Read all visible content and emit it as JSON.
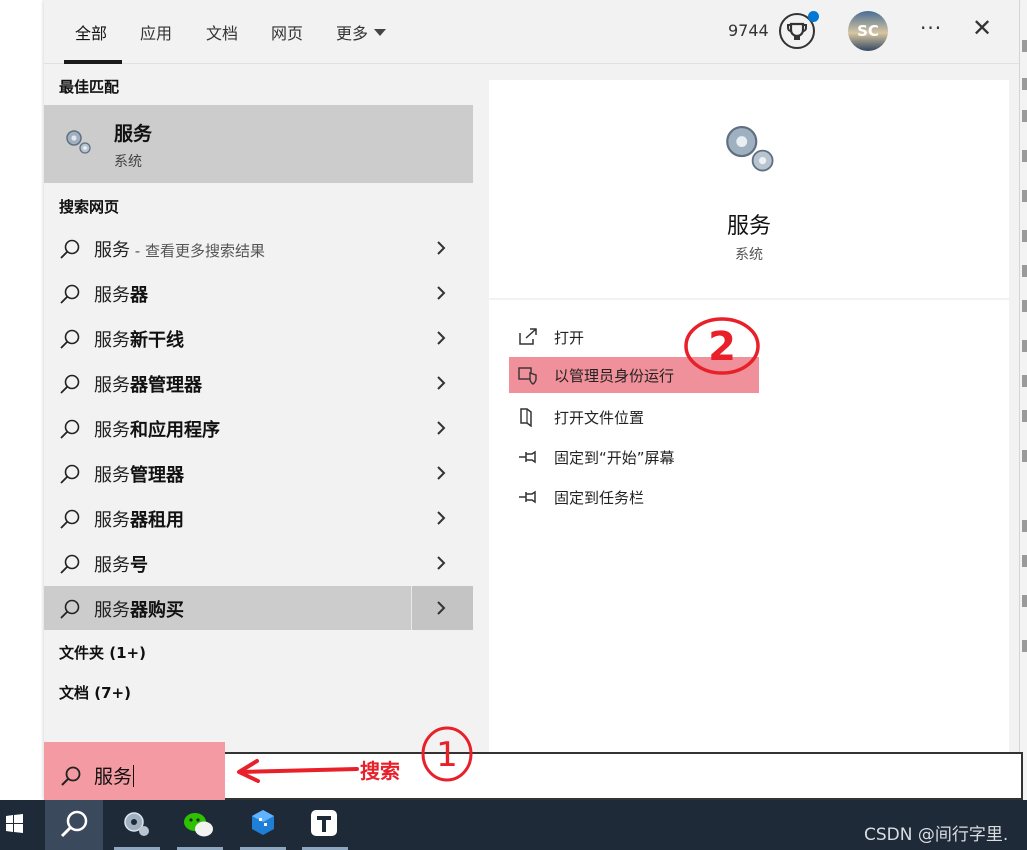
{
  "tabs": [
    {
      "label": "全部",
      "active": true
    },
    {
      "label": "应用"
    },
    {
      "label": "文档"
    },
    {
      "label": "网页"
    },
    {
      "label": "更多"
    }
  ],
  "header": {
    "points": "9744",
    "avatar_initials": "SC",
    "more_icon": "···",
    "close_icon": "✕"
  },
  "best_match": {
    "section_title": "最佳匹配",
    "title": "服务",
    "subtitle": "系统",
    "icon": "gears-icon"
  },
  "web_search": {
    "section_title": "搜索网页",
    "items": [
      {
        "prefix": "服务",
        "bold": "",
        "suffix": " - 查看更多搜索结果"
      },
      {
        "prefix": "服务",
        "bold": "器",
        "suffix": ""
      },
      {
        "prefix": "服务",
        "bold": "新干线",
        "suffix": ""
      },
      {
        "prefix": "服务",
        "bold": "器管理器",
        "suffix": ""
      },
      {
        "prefix": "服务",
        "bold": "和应用程序",
        "suffix": ""
      },
      {
        "prefix": "服务",
        "bold": "管理器",
        "suffix": ""
      },
      {
        "prefix": "服务",
        "bold": "器租用",
        "suffix": ""
      },
      {
        "prefix": "服务",
        "bold": "号",
        "suffix": ""
      },
      {
        "prefix": "服务",
        "bold": "器购买",
        "suffix": "",
        "selected": true
      }
    ]
  },
  "categories": [
    {
      "label": "文件夹 (1+)"
    },
    {
      "label": "文档 (7+)"
    }
  ],
  "detail": {
    "title": "服务",
    "subtitle": "系统",
    "actions": [
      {
        "label": "打开",
        "icon": "open-external-icon"
      },
      {
        "label": "以管理员身份运行",
        "icon": "shield-icon",
        "highlighted": true
      },
      {
        "label": "打开文件位置",
        "icon": "folder-location-icon"
      },
      {
        "label": "固定到“开始”屏幕",
        "icon": "pin-icon"
      },
      {
        "label": "固定到任务栏",
        "icon": "pin-icon"
      }
    ]
  },
  "search": {
    "value": "服务"
  },
  "annotations": {
    "search_label": "搜索",
    "step1": "1",
    "step2": "2",
    "color": "#e8202a"
  },
  "taskbar": {
    "items": [
      "windows-start-icon",
      "search-icon",
      "settings-icon",
      "wechat-icon",
      "cube-app-icon",
      "typora-icon"
    ]
  },
  "watermark": "CSDN @间行字里.",
  "colors": {
    "panel_bg": "#f2f2f2",
    "selected_bg": "#cccccc",
    "highlight": "#f0909a",
    "taskbar_bg": "#1e2a38"
  }
}
